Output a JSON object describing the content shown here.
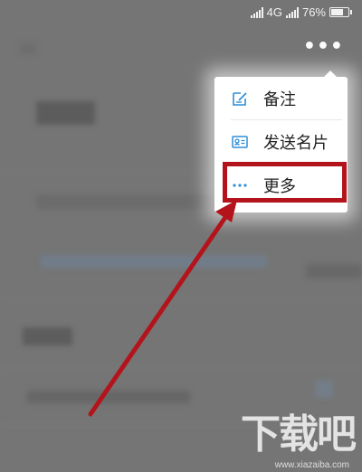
{
  "status_bar": {
    "network": "4G",
    "battery_text": "76%",
    "battery_level": 0.76
  },
  "header": {
    "more_label": "•••"
  },
  "popup_menu": {
    "items": [
      {
        "label": "备注",
        "icon": "edit-note-icon"
      },
      {
        "label": "发送名片",
        "icon": "contact-card-icon"
      },
      {
        "label": "更多",
        "icon": "more-dots-icon"
      }
    ]
  },
  "annotation": {
    "highlight_color": "#b3141c",
    "target_item": "更多"
  },
  "watermark": {
    "brand": "下载吧",
    "url": "www.xiazaiba.com"
  },
  "colors": {
    "accent": "#2e8fd8",
    "annotation_red": "#b3141c"
  }
}
